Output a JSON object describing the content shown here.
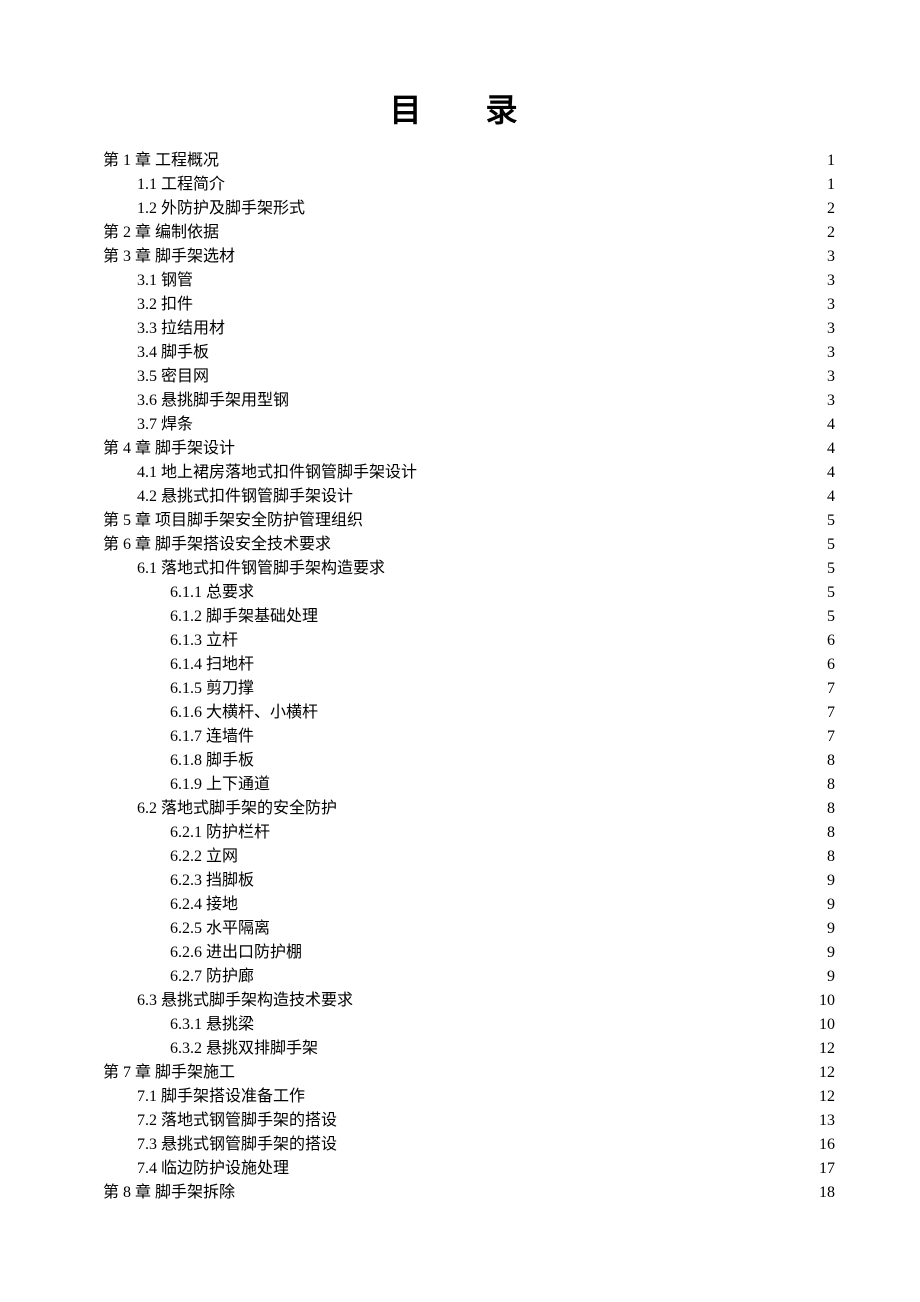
{
  "title": "目 录",
  "entries": [
    {
      "level": 1,
      "label": "第 1 章  工程概况",
      "page": "1"
    },
    {
      "level": 2,
      "label": "1.1  工程简介",
      "page": "1"
    },
    {
      "level": 2,
      "label": "1.2  外防护及脚手架形式",
      "page": "2"
    },
    {
      "level": 1,
      "label": "第 2 章  编制依据",
      "page": "2"
    },
    {
      "level": 1,
      "label": "第 3 章  脚手架选材",
      "page": "3"
    },
    {
      "level": 2,
      "label": "3.1  钢管",
      "page": "3"
    },
    {
      "level": 2,
      "label": "3.2  扣件",
      "page": "3"
    },
    {
      "level": 2,
      "label": "3.3  拉结用材",
      "page": "3"
    },
    {
      "level": 2,
      "label": "3.4  脚手板",
      "page": "3"
    },
    {
      "level": 2,
      "label": "3.5  密目网",
      "page": "3"
    },
    {
      "level": 2,
      "label": "3.6  悬挑脚手架用型钢",
      "page": "3"
    },
    {
      "level": 2,
      "label": "3.7  焊条",
      "page": "4"
    },
    {
      "level": 1,
      "label": "第 4 章  脚手架设计",
      "page": "4"
    },
    {
      "level": 2,
      "label": "4.1  地上裙房落地式扣件钢管脚手架设计",
      "page": "4"
    },
    {
      "level": 2,
      "label": "4.2  悬挑式扣件钢管脚手架设计",
      "page": "4"
    },
    {
      "level": 1,
      "label": "第 5 章  项目脚手架安全防护管理组织",
      "page": "5"
    },
    {
      "level": 1,
      "label": "第 6 章  脚手架搭设安全技术要求",
      "page": "5"
    },
    {
      "level": 2,
      "label": "6.1  落地式扣件钢管脚手架构造要求",
      "page": "5"
    },
    {
      "level": 3,
      "label": "6.1.1  总要求",
      "page": "5"
    },
    {
      "level": 3,
      "label": "6.1.2  脚手架基础处理",
      "page": "5"
    },
    {
      "level": 3,
      "label": "6.1.3  立杆",
      "page": "6"
    },
    {
      "level": 3,
      "label": "6.1.4  扫地杆",
      "page": "6"
    },
    {
      "level": 3,
      "label": "6.1.5  剪刀撑",
      "page": "7"
    },
    {
      "level": 3,
      "label": "6.1.6  大横杆、小横杆",
      "page": "7"
    },
    {
      "level": 3,
      "label": "6.1.7  连墙件",
      "page": "7"
    },
    {
      "level": 3,
      "label": "6.1.8  脚手板",
      "page": "8"
    },
    {
      "level": 3,
      "label": "6.1.9  上下通道",
      "page": "8"
    },
    {
      "level": 2,
      "label": "6.2  落地式脚手架的安全防护",
      "page": "8"
    },
    {
      "level": 3,
      "label": "6.2.1  防护栏杆",
      "page": "8"
    },
    {
      "level": 3,
      "label": "6.2.2  立网",
      "page": "8"
    },
    {
      "level": 3,
      "label": "6.2.3  挡脚板",
      "page": "9"
    },
    {
      "level": 3,
      "label": "6.2.4  接地",
      "page": "9"
    },
    {
      "level": 3,
      "label": "6.2.5  水平隔离",
      "page": "9"
    },
    {
      "level": 3,
      "label": "6.2.6  进出口防护棚",
      "page": "9"
    },
    {
      "level": 3,
      "label": "6.2.7  防护廊",
      "page": "9"
    },
    {
      "level": 2,
      "label": "6.3  悬挑式脚手架构造技术要求",
      "page": "10"
    },
    {
      "level": 3,
      "label": "6.3.1  悬挑梁",
      "page": "10"
    },
    {
      "level": 3,
      "label": "6.3.2  悬挑双排脚手架",
      "page": "12"
    },
    {
      "level": 1,
      "label": "第 7 章  脚手架施工",
      "page": "12"
    },
    {
      "level": 2,
      "label": "7.1  脚手架搭设准备工作",
      "page": "12"
    },
    {
      "level": 2,
      "label": "7.2  落地式钢管脚手架的搭设",
      "page": "13"
    },
    {
      "level": 2,
      "label": "7.3  悬挑式钢管脚手架的搭设",
      "page": "16"
    },
    {
      "level": 2,
      "label": "7.4  临边防护设施处理",
      "page": "17"
    },
    {
      "level": 1,
      "label": "第 8 章  脚手架拆除",
      "page": "18"
    }
  ]
}
